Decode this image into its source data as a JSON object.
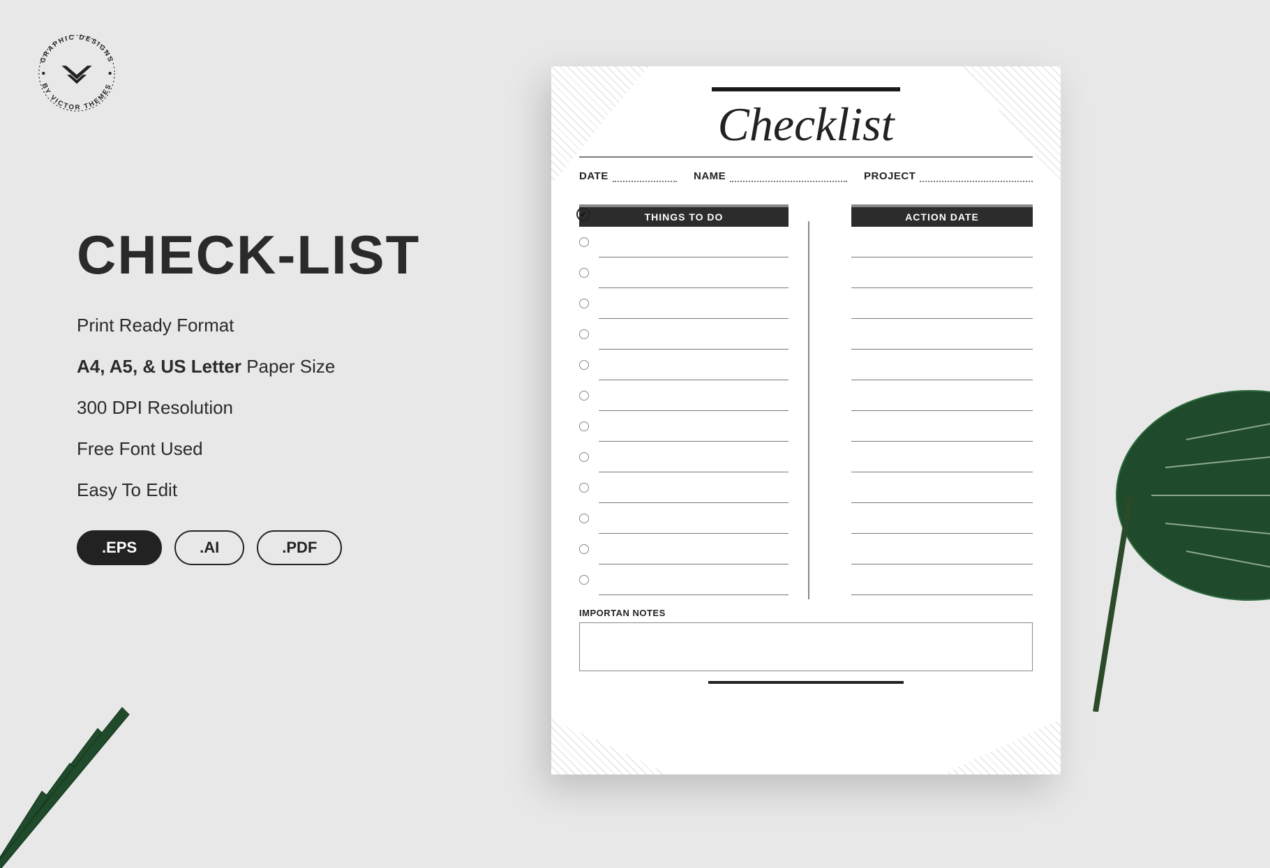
{
  "logo": {
    "top_text": "GRAPHIC DESIGNS",
    "bottom_text": "BY VICTOR THEMES"
  },
  "left": {
    "headline": "CHECK-LIST",
    "features": {
      "f1": "Print Ready Format",
      "f2_bold": "A4, A5, & US Letter",
      "f2_rest": " Paper Size",
      "f3": "300 DPI Resolution",
      "f4": "Free Font Used",
      "f5": "Easy To Edit"
    },
    "formats": {
      "eps": ".EPS",
      "ai": ".AI",
      "pdf": ".PDF"
    }
  },
  "paper": {
    "title": "Checklist",
    "meta": {
      "date": "DATE",
      "name": "NAME",
      "project": "PROJECT"
    },
    "tabs": {
      "things": "THINGS TO DO",
      "action": "ACTION DATE"
    },
    "row_count": 12,
    "notes_label": "IMPORTAN NOTES"
  }
}
